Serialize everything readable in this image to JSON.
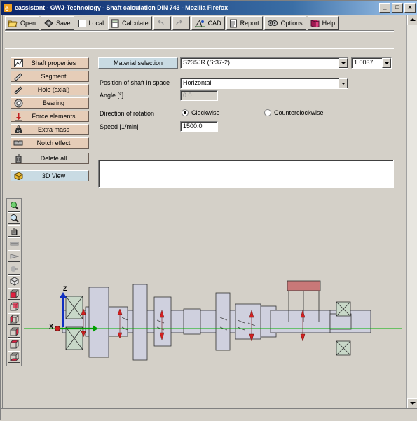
{
  "window": {
    "title": "eassistant - GWJ-Technology - Shaft calculation DIN 743 - Mozilla Firefox",
    "minimize": "_",
    "maximize": "□",
    "close": "x"
  },
  "toolbar": {
    "open": "Open",
    "save": "Save",
    "local": "Local",
    "calculate": "Calculate",
    "cad": "CAD",
    "report": "Report",
    "options": "Options",
    "help": "Help"
  },
  "sidebar": {
    "items": [
      {
        "label": "Shaft properties",
        "icon": "chart-icon"
      },
      {
        "label": "Segment",
        "icon": "segment-icon"
      },
      {
        "label": "Hole (axial)",
        "icon": "hole-icon"
      },
      {
        "label": "Bearing",
        "icon": "bearing-icon"
      },
      {
        "label": "Force elements",
        "icon": "force-icon"
      },
      {
        "label": "Extra mass",
        "icon": "weight-icon"
      },
      {
        "label": "Notch effect",
        "icon": "notch-icon"
      }
    ],
    "delete_all": "Delete all",
    "view_3d": "3D View"
  },
  "form": {
    "material_button": "Material selection",
    "material_value": "S235JR (St37-2)",
    "material_number": "1.0037",
    "position_label": "Position of shaft in space",
    "position_value": "Horizontal",
    "angle_label": "Angle [°]",
    "angle_value": "0.0",
    "rotation_label": "Direction of rotation",
    "clockwise": "Clockwise",
    "counterclockwise": "Counterclockwise",
    "speed_label": "Speed [1/min]",
    "speed_value": "1500.0"
  },
  "view_tools": [
    "zoom-fit-icon",
    "zoom-icon",
    "pan-hand-icon",
    "view-1-icon",
    "view-2-icon",
    "view-3-icon",
    "view-iso-icon",
    "view-front-icon",
    "view-back-icon",
    "view-left-icon",
    "view-right-icon",
    "view-top-icon",
    "view-bottom-icon"
  ],
  "axes": {
    "z": "Z",
    "x": "X"
  },
  "colors": {
    "sidebar_button": "#e6cdb8",
    "blue_button": "#c9dbe3",
    "axis_line": "#00b000",
    "force_arrow": "#d42020"
  }
}
